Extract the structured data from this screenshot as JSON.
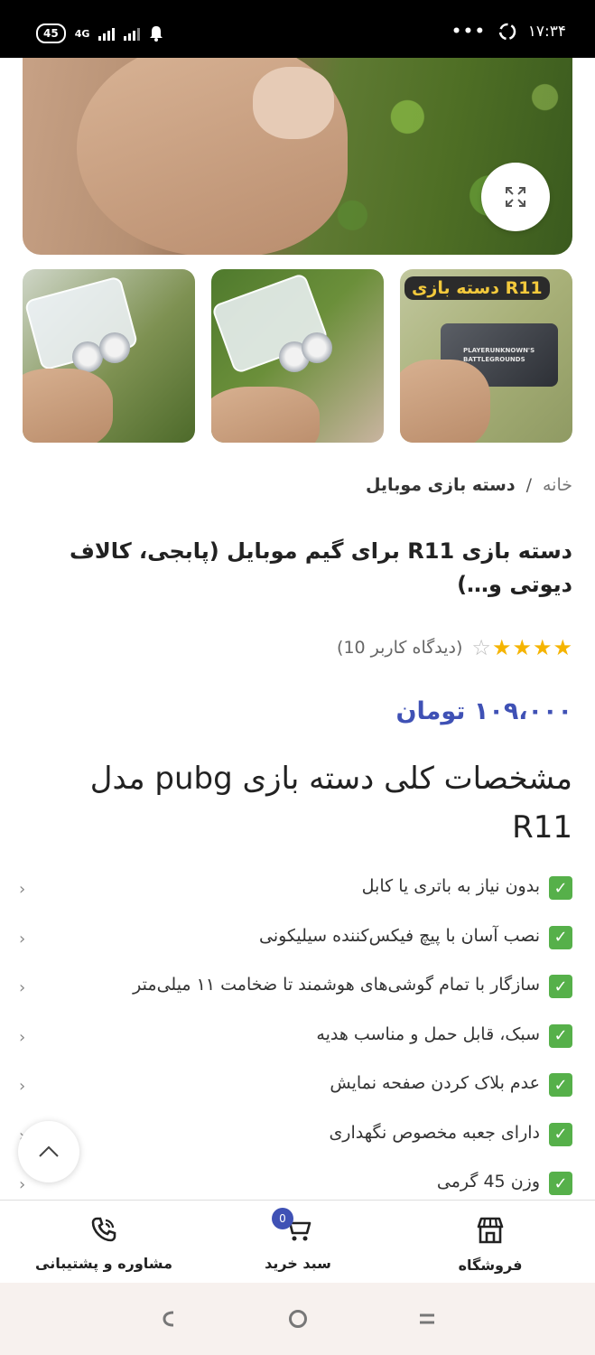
{
  "status_bar": {
    "battery": "45",
    "network": "4G",
    "time": "۱۷:۳۴"
  },
  "gallery": {
    "main_image_alt": "",
    "thumbnails": [
      {
        "badge": ""
      },
      {
        "badge": ""
      },
      {
        "badge": "دسته بازی R11",
        "box_text": "PLAYERUNKNOWN'S BATTLEGROUNDS"
      }
    ]
  },
  "breadcrumb": {
    "home": "خانه",
    "separator": "/",
    "current": "دسته بازی موبایل"
  },
  "product": {
    "title": "دسته بازی R11 برای گیم موبایل (پابجی، کالاف دیوتی و…)",
    "rating": 4,
    "rating_max": 5,
    "reviews": "(دیدگاه کاربر 10)",
    "price": "۱۰۹،۰۰۰ تومان"
  },
  "specs": {
    "heading": "مشخصات کلی دسته بازی pubg مدل R11",
    "items": [
      "بدون نیاز به باتری یا کابل",
      "نصب آسان با پیچ فیکس‌کننده سیلیکونی",
      "سازگار با تمام گوشی‌های هوشمند تا ضخامت ۱۱ میلی‌متر",
      "سبک، قابل حمل و مناسب هدیه",
      "عدم بلاک کردن صفحه نمایش",
      "دارای جعبه مخصوص نگهداری",
      "وزن 45 گرمی"
    ]
  },
  "bottom_nav": {
    "support": "مشاوره و پشتیبانی",
    "cart": "سبد خرید",
    "cart_count": "0",
    "shop": "فروشگاه"
  },
  "colors": {
    "accent": "#3f51b5",
    "star": "#f5b400",
    "check": "#56b04a"
  }
}
